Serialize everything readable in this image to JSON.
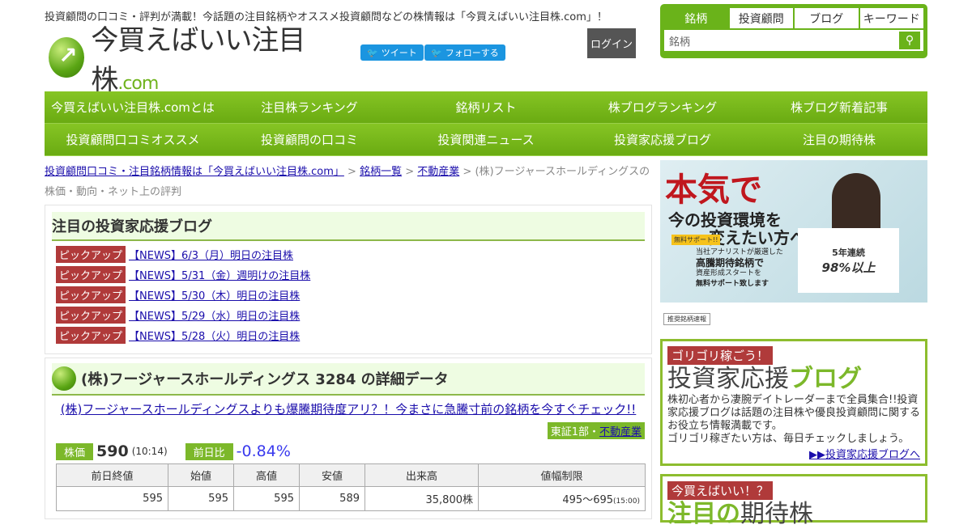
{
  "header": {
    "tagline": "投資顧問の口コミ・評判が満載！今話題の注目銘柄やオススメ投資顧問などの株情報は「今買えばいい注目株.com」！",
    "logo_text": "今買えばいい注目株",
    "logo_suffix": ".com",
    "tweet": "ツイート",
    "follow": "フォローする",
    "login": "ログイン"
  },
  "search": {
    "tabs": [
      "銘柄",
      "投資顧問",
      "ブログ",
      "キーワード"
    ],
    "placeholder": "銘柄"
  },
  "nav": {
    "row1": [
      "今買えばいい注目株.comとは",
      "注目株ランキング",
      "銘柄リスト",
      "株ブログランキング",
      "株ブログ新着記事"
    ],
    "row2": [
      "投資顧問口コミオススメ",
      "投資顧問の口コミ",
      "投資関連ニュース",
      "投資家応援ブログ",
      "注目の期待株"
    ]
  },
  "breadcrumb": {
    "home": "投資顧問口コミ・注目銘柄情報は「今買えばいい注目株.com」",
    "list": "銘柄一覧",
    "sector": "不動産業",
    "current": "(株)フージャースホールディングスの株価・動向・ネット上の評判"
  },
  "blog": {
    "title": "注目の投資家応援ブログ",
    "label": "ピックアップ",
    "items": [
      "【NEWS】6/3（月）明日の注目株",
      "【NEWS】5/31（金）週明けの注目株",
      "【NEWS】5/30（木）明日の注目株",
      "【NEWS】5/29（水）明日の注目株",
      "【NEWS】5/28（火）明日の注目株"
    ]
  },
  "detail": {
    "title": "(株)フージャースホールディングス 3284 の詳細データ",
    "promo": "(株)フージャースホールディングスよりも爆騰期待度アリ？！今まさに急騰寸前の銘柄を今すぐチェック!!",
    "market": "東証1部・",
    "sector": "不動産業",
    "price_label": "株価",
    "price": "590",
    "price_time": "(10:14)",
    "change_label": "前日比",
    "change": "-0.84%",
    "headers": [
      "前日終値",
      "始値",
      "高値",
      "安値",
      "出来高",
      "値幅制限"
    ],
    "values": [
      "595",
      "595",
      "595",
      "589",
      "35,800株",
      "495～695"
    ],
    "limit_time": "(15:00)"
  },
  "ad": {
    "headline1": "本気で",
    "headline2": "今の投資環境を",
    "headline3": "変えたい方へ",
    "badge": "無料サポート!!",
    "body1": "当社アナリストが厳選した",
    "body2": "高騰期待銘柄で",
    "body3": "資産形成スタートを",
    "body4": "無料サポート致します",
    "sign1": "5年連続",
    "sign2": "98%以上",
    "ticker_label": "推奨銘柄速報"
  },
  "side1": {
    "label": "ゴリゴリ稼ごう！",
    "title_a": "投資家応援",
    "title_b": "ブログ",
    "text": "株初心者から凄腕デイトレーダーまで全員集合!!投資家応援ブログは話題の注目株や優良投資顧問に関するお役立ち情報満載です。\nゴリゴリ稼ぎたい方は、毎日チェックしましょう。",
    "link": "▶▶投資家応援ブログへ"
  },
  "side2": {
    "label": "今買えばいい！？",
    "title_a": "注目の",
    "title_b": "期待株"
  }
}
